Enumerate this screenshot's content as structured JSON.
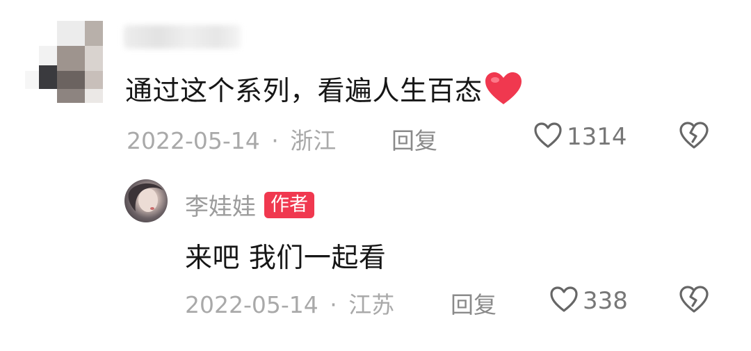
{
  "comments": [
    {
      "text": "通过这个系列，看遍人生百态",
      "date": "2022-05-14",
      "separator": "·",
      "location": "浙江",
      "reply_label": "回复",
      "like_count": "1314"
    }
  ],
  "reply": {
    "author": "李娃娃",
    "author_tag": "作者",
    "text": "来吧 我们一起看",
    "date": "2022-05-14",
    "separator": "·",
    "location": "江苏",
    "reply_label": "回复",
    "like_count": "338"
  },
  "colors": {
    "heart_emoji": "#f0384f",
    "author_tag_bg": "#f0384f",
    "meta_text": "#a9a9a9"
  },
  "icons": [
    "heart-emoji-icon",
    "like-heart-icon",
    "dislike-broken-heart-icon"
  ]
}
